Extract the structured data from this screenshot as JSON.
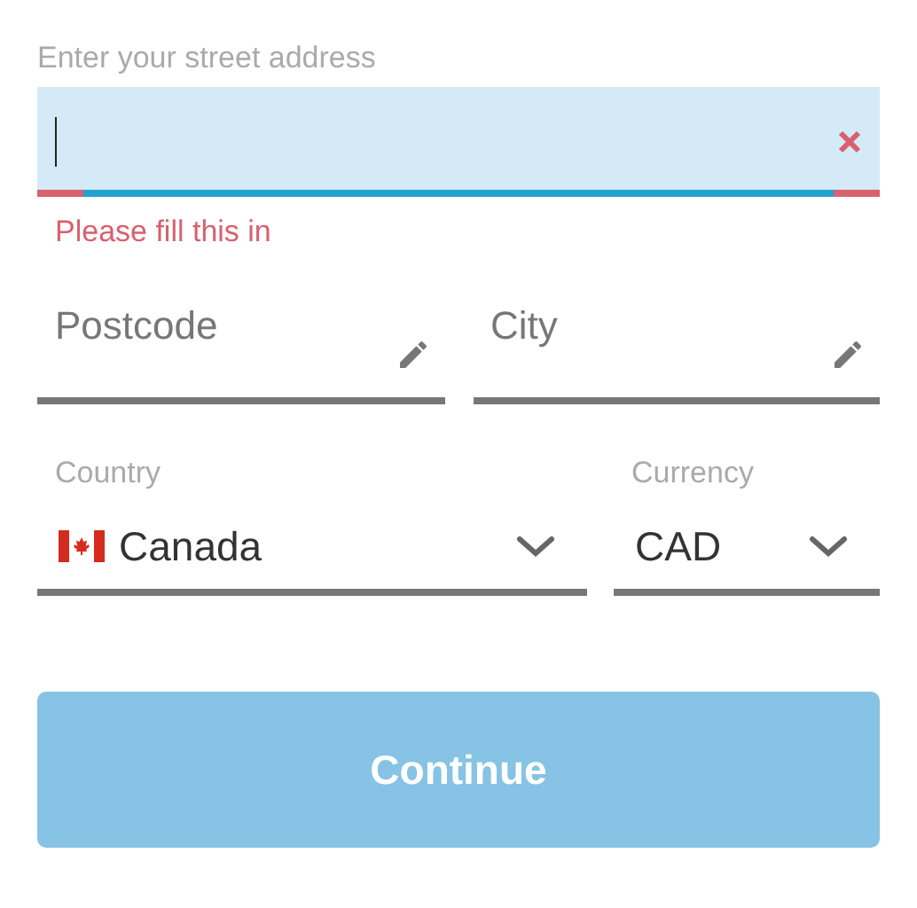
{
  "address": {
    "label": "Enter your street address",
    "focused": true,
    "error": "Please fill this in"
  },
  "fields": [
    {
      "placeholder": "Postcode"
    },
    {
      "placeholder": "City"
    }
  ],
  "selects": [
    {
      "label": "Country",
      "value": "Canada",
      "kind": "country"
    },
    {
      "label": "Currency",
      "value": "CAD",
      "kind": "currency"
    }
  ],
  "continue_button": {
    "label": "Continue",
    "disabled": true
  }
}
